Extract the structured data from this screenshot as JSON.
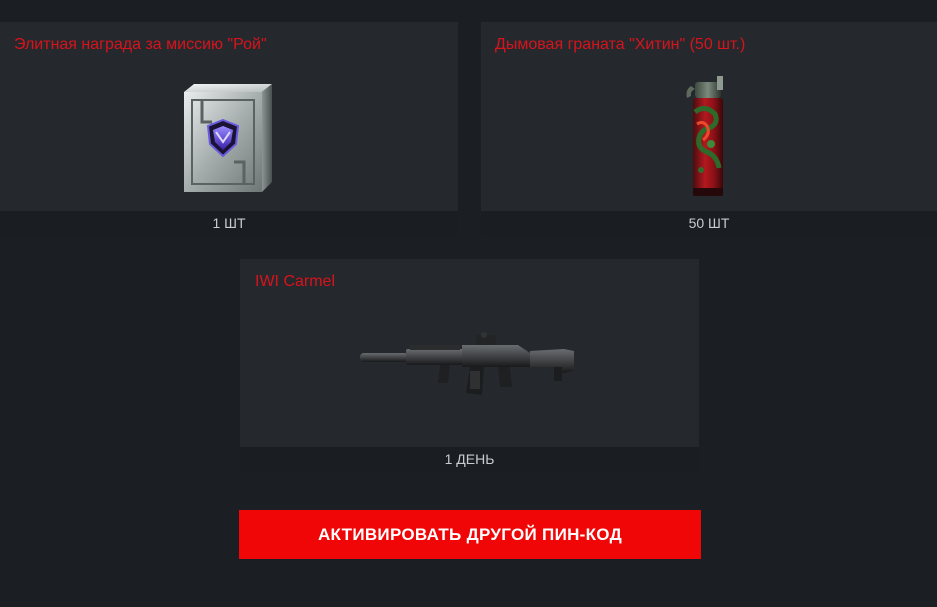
{
  "rewards": [
    {
      "title": "Элитная награда за миссию \"Рой\"",
      "quantity": "1 ШТ",
      "icon": "elite-reward-box-icon"
    },
    {
      "title": "Дымовая граната \"Хитин\" (50 шт.)",
      "quantity": "50 ШТ",
      "icon": "smoke-grenade-icon"
    },
    {
      "title": "IWI Carmel",
      "quantity": "1 ДЕНЬ",
      "icon": "rifle-icon"
    }
  ],
  "actions": {
    "activate_label": "АКТИВИРОВАТЬ ДРУГОЙ ПИН-КОД"
  },
  "colors": {
    "background": "#1b1e22",
    "card": "#25292e",
    "title_red": "#d8131b",
    "button_red": "#f00606"
  }
}
